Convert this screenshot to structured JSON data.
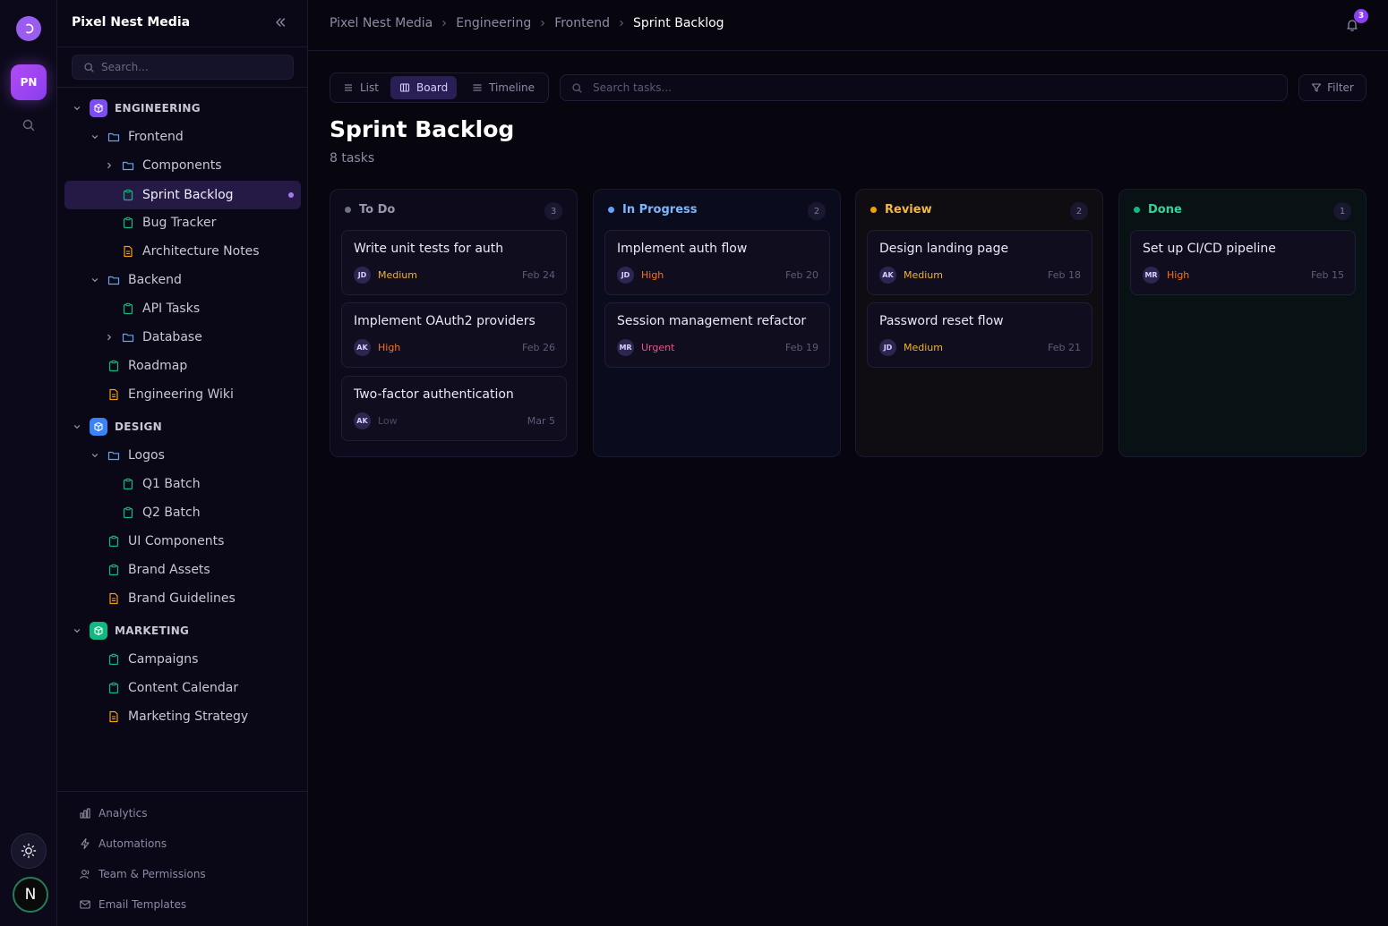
{
  "workspace": {
    "initials": "PN",
    "name": "Pixel Nest Media"
  },
  "user": {
    "initial": "N"
  },
  "sidebar": {
    "search_placeholder": "Search...",
    "sections": [
      {
        "label": "ENGINEERING",
        "color": "#8b5cf6"
      },
      {
        "label": "DESIGN",
        "color": "#3b82f6"
      },
      {
        "label": "MARKETING",
        "color": "#10b981"
      }
    ],
    "items": {
      "frontend": "Frontend",
      "components": "Components",
      "sprint_backlog": "Sprint Backlog",
      "bug_tracker": "Bug Tracker",
      "architecture_notes": "Architecture Notes",
      "backend": "Backend",
      "api_tasks": "API Tasks",
      "database": "Database",
      "roadmap": "Roadmap",
      "engineering_wiki": "Engineering Wiki",
      "logos": "Logos",
      "q1_batch": "Q1 Batch",
      "q2_batch": "Q2 Batch",
      "ui_components": "UI Components",
      "brand_assets": "Brand Assets",
      "brand_guidelines": "Brand Guidelines",
      "campaigns": "Campaigns",
      "content_calendar": "Content Calendar",
      "marketing_strategy": "Marketing Strategy"
    },
    "bottom": {
      "analytics": "Analytics",
      "automations": "Automations",
      "team": "Team & Permissions",
      "email": "Email Templates"
    }
  },
  "breadcrumb": [
    "Pixel Nest Media",
    "Engineering",
    "Frontend",
    "Sprint Backlog"
  ],
  "notifications": {
    "count": "3"
  },
  "toolbar": {
    "views": [
      "List",
      "Board",
      "Timeline"
    ],
    "active_view": "Board",
    "search_placeholder": "Search tasks...",
    "filter_label": "Filter"
  },
  "page": {
    "title": "Sprint Backlog",
    "subtitle": "8 tasks"
  },
  "colors": {
    "todo": "#6b7280",
    "in_progress": "#60a5fa",
    "review": "#f59e0b",
    "done": "#10b981",
    "priority_medium": "#f0b429",
    "priority_high": "#f97316",
    "priority_urgent": "#f0508c",
    "priority_low": "#4b4862"
  },
  "columns": [
    {
      "title": "To Do",
      "count": "3",
      "cards": [
        {
          "title": "Write unit tests for auth",
          "assignee": "JD",
          "priority": "Medium",
          "due": "Feb 24"
        },
        {
          "title": "Implement OAuth2 providers",
          "assignee": "AK",
          "priority": "High",
          "due": "Feb 26"
        },
        {
          "title": "Two-factor authentication",
          "assignee": "AK",
          "priority": "Low",
          "due": "Mar 5"
        }
      ]
    },
    {
      "title": "In Progress",
      "count": "2",
      "cards": [
        {
          "title": "Implement auth flow",
          "assignee": "JD",
          "priority": "High",
          "due": "Feb 20"
        },
        {
          "title": "Session management refactor",
          "assignee": "MR",
          "priority": "Urgent",
          "due": "Feb 19"
        }
      ]
    },
    {
      "title": "Review",
      "count": "2",
      "cards": [
        {
          "title": "Design landing page",
          "assignee": "AK",
          "priority": "Medium",
          "due": "Feb 18"
        },
        {
          "title": "Password reset flow",
          "assignee": "JD",
          "priority": "Medium",
          "due": "Feb 21"
        }
      ]
    },
    {
      "title": "Done",
      "count": "1",
      "cards": [
        {
          "title": "Set up CI/CD pipeline",
          "assignee": "MR",
          "priority": "High",
          "due": "Feb 15"
        }
      ]
    }
  ]
}
